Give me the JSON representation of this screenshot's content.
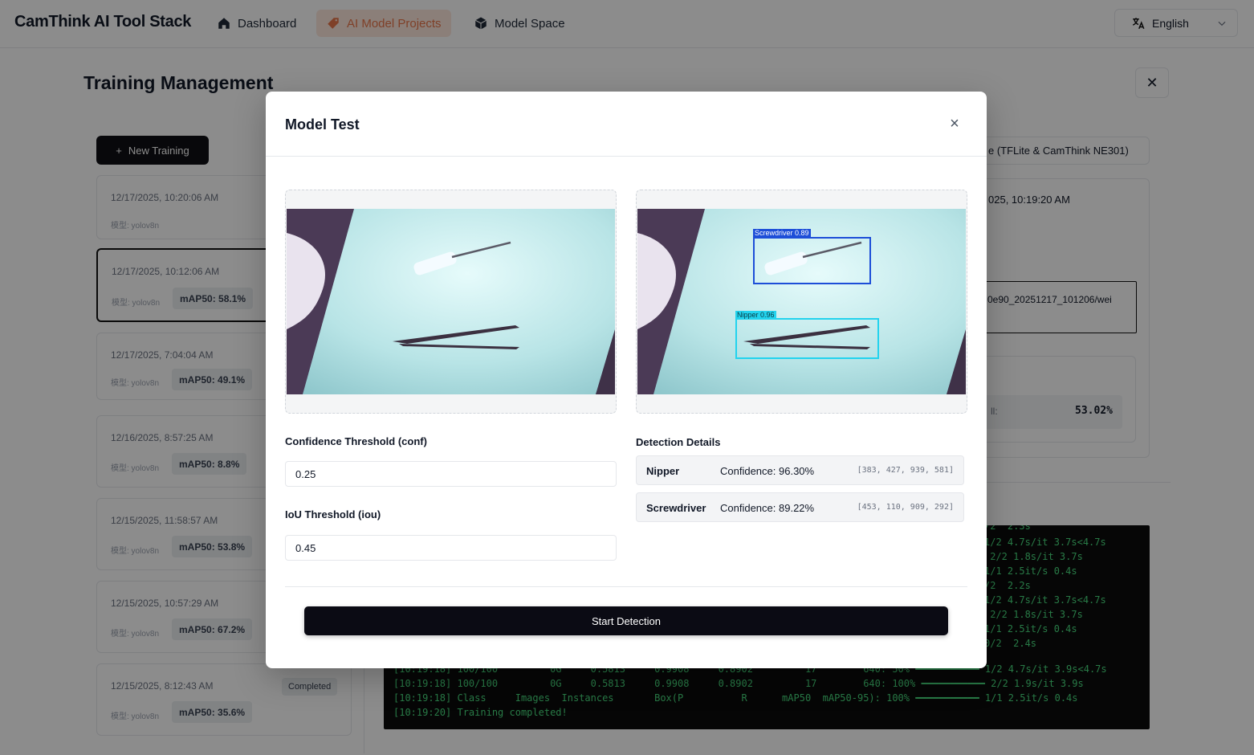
{
  "app": {
    "brand": "CamThink AI Tool Stack"
  },
  "nav": {
    "items": [
      {
        "label": "Dashboard",
        "icon": "home-icon"
      },
      {
        "label": "AI Model Projects",
        "icon": "tag-icon",
        "active": true
      },
      {
        "label": "Model Space",
        "icon": "cube-icon"
      }
    ],
    "language": "English"
  },
  "page": {
    "title": "Training Management",
    "new_training_label": "New Training",
    "export_label": "e (TFLite & CamThink NE301)",
    "runs": [
      {
        "date": "12/17/2025, 10:20:06 AM",
        "model": "模型: yolov8n",
        "map": "",
        "status": ""
      },
      {
        "date": "12/17/2025, 10:12:06 AM",
        "model": "模型: yolov8n",
        "map": "mAP50: 58.1%",
        "status": ""
      },
      {
        "date": "12/17/2025, 7:04:04 AM",
        "model": "模型: yolov8n",
        "map": "mAP50: 49.1%",
        "status": ""
      },
      {
        "date": "12/16/2025, 8:57:25 AM",
        "model": "模型: yolov8n",
        "map": "mAP50: 8.8%",
        "status": ""
      },
      {
        "date": "12/15/2025, 11:58:57 AM",
        "model": "模型: yolov8n",
        "map": "mAP50: 53.8%",
        "status": ""
      },
      {
        "date": "12/15/2025, 10:57:29 AM",
        "model": "模型: yolov8n",
        "map": "mAP50: 67.2%",
        "status": ""
      },
      {
        "date": "12/15/2025, 8:12:43 AM",
        "model": "模型: yolov8n",
        "map": "mAP50: 35.6%",
        "status": "Completed"
      }
    ],
    "detail": {
      "date": "025, 10:19:20 AM",
      "path": "0e90_20251217_101206/wei",
      "metric_label": "ll:",
      "metric_value": "53.02%"
    },
    "log_right": [
      "/2  2.3s",
      "1/2 4.7s/it 3.7s<4.7s",
      " 2/2 1.8s/it 3.7s",
      "1/1 2.5it/s 0.4s",
      "/2  2.2s",
      "1/2 4.7s/it 3.7s<4.7s",
      " 2/2 1.8s/it 3.7s",
      "1/1 2.5it/s 0.4s",
      "0/2  2.4s"
    ],
    "log_full": [
      "[10:19:18] 100/100         0G     0.5813     0.9908     0.8902         17        640: 50% ━━━━━━━━━━━ 1/2 4.7s/it 3.9s<4.7s",
      "[10:19:18] 100/100         0G     0.5813     0.9908     0.8902         17        640: 100% ━━━━━━━━━━━ 2/2 1.9s/it 3.9s",
      "[10:19:18] Class     Images  Instances       Box(P          R      mAP50  mAP50-95): 100% ━━━━━━━━━━━ 1/1 2.5it/s 0.4s",
      "[10:19:20] Training completed!"
    ]
  },
  "modal": {
    "title": "Model Test",
    "close_symbol": "×",
    "conf_label": "Confidence Threshold (conf)",
    "conf_value": "0.25",
    "iou_label": "IoU Threshold (iou)",
    "iou_value": "0.45",
    "details_title": "Detection Details",
    "detections": [
      {
        "class": "Nipper",
        "confidence": "Confidence: 96.30%",
        "bbox": "[383, 427, 939, 581]",
        "overlay_label": "Nipper 0.96",
        "color": "#22d3ee"
      },
      {
        "class": "Screwdriver",
        "confidence": "Confidence: 89.22%",
        "bbox": "[453, 110, 909, 292]",
        "overlay_label": "Screwdriver 0.89",
        "color": "#1d4ed8"
      }
    ],
    "start_label": "Start Detection"
  }
}
